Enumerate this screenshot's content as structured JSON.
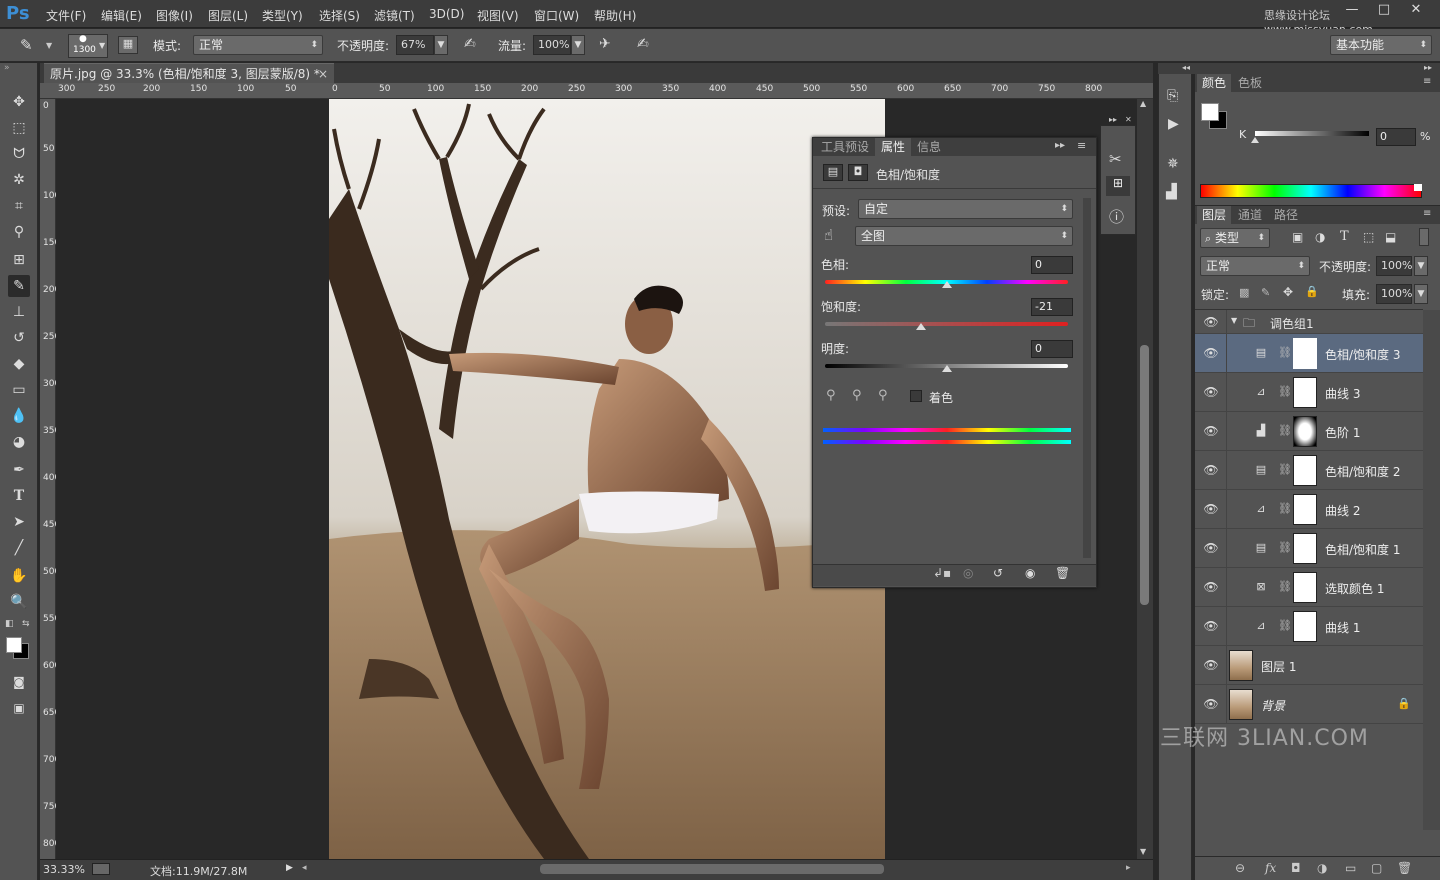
{
  "menubar": {
    "logo": "Ps",
    "items": [
      "文件(F)",
      "编辑(E)",
      "图像(I)",
      "图层(L)",
      "类型(Y)",
      "选择(S)",
      "滤镜(T)",
      "3D(D)",
      "视图(V)",
      "窗口(W)",
      "帮助(H)"
    ],
    "watermark": "思缘设计论坛 www.missyuan.com",
    "min": "—",
    "max": "□",
    "close": "✕"
  },
  "options": {
    "brush_size": "1300",
    "mode_label": "模式:",
    "mode_value": "正常",
    "opacity_label": "不透明度:",
    "opacity_value": "67%",
    "flow_label": "流量:",
    "flow_value": "100%",
    "workspace": "基本功能"
  },
  "document": {
    "tab_title": "原片.jpg @ 33.3% (色相/饱和度 3, 图层蒙版/8) *",
    "tab_close": "×",
    "ruler_h_left": [
      "300",
      "250",
      "200",
      "150",
      "100",
      "50",
      "0"
    ],
    "ruler_h_right": [
      "0",
      "50",
      "100",
      "150",
      "200",
      "250",
      "300",
      "350",
      "400",
      "450",
      "500",
      "550",
      "600",
      "650",
      "700",
      "750",
      "800"
    ],
    "ruler_v": [
      "0",
      "50",
      "100",
      "150",
      "200",
      "250",
      "300",
      "350",
      "400",
      "450",
      "500",
      "550",
      "600",
      "650",
      "700",
      "750",
      "800"
    ],
    "zoom": "33.33%",
    "doc_info": "文档:11.9M/27.8M"
  },
  "properties": {
    "tabs": [
      "工具预设",
      "属性",
      "信息"
    ],
    "active_tab": "属性",
    "title": "色相/饱和度",
    "preset_label": "预设:",
    "preset_value": "自定",
    "range_value": "全图",
    "hue_label": "色相:",
    "hue_value": "0",
    "saturation_label": "饱和度:",
    "saturation_value": "-21",
    "lightness_label": "明度:",
    "lightness_value": "0",
    "colorize_label": "着色"
  },
  "color_panel": {
    "tabs": [
      "颜色",
      "色板"
    ],
    "k_label": "K",
    "k_value": "0",
    "k_unit": "%"
  },
  "layers_panel": {
    "tabs": [
      "图层",
      "通道",
      "路径"
    ],
    "filter_label": "类型",
    "blend_mode": "正常",
    "opacity_label": "不透明度:",
    "opacity_value": "100%",
    "lock_label": "锁定:",
    "fill_label": "填充:",
    "fill_value": "100%",
    "group_name": "调色组1",
    "layers": [
      {
        "name": "色相/饱和度 3",
        "type": "hue",
        "selected": true
      },
      {
        "name": "曲线 3",
        "type": "curves",
        "selected": false
      },
      {
        "name": "色阶 1",
        "type": "levels",
        "selected": false
      },
      {
        "name": "色相/饱和度 2",
        "type": "hue",
        "selected": false
      },
      {
        "name": "曲线 2",
        "type": "curves",
        "selected": false
      },
      {
        "name": "色相/饱和度 1",
        "type": "hue",
        "selected": false
      },
      {
        "name": "选取颜色 1",
        "type": "selective",
        "selected": false
      },
      {
        "name": "曲线 1",
        "type": "curves",
        "selected": false
      }
    ],
    "layer1_name": "图层 1",
    "background_name": "背景",
    "bottom_icons": [
      "⊖",
      "fx",
      "◘",
      "◑",
      "▭",
      "▢",
      "🗑"
    ]
  },
  "watermark_bottom": "三联网 3LIAN.COM"
}
